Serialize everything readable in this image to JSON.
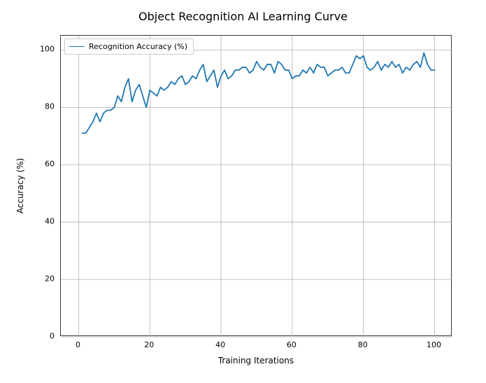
{
  "chart_data": {
    "type": "line",
    "title": "Object Recognition AI Learning Curve",
    "xlabel": "Training Iterations",
    "ylabel": "Accuracy (%)",
    "xlim": [
      -5,
      105
    ],
    "ylim": [
      0,
      105
    ],
    "xticks": [
      0,
      20,
      40,
      60,
      80,
      100
    ],
    "yticks": [
      0,
      20,
      40,
      60,
      80,
      100
    ],
    "legend": {
      "position": "upper-left"
    },
    "series": [
      {
        "name": "Recognition Accuracy (%)",
        "color": "#1f77b4",
        "x": [
          1,
          2,
          3,
          4,
          5,
          6,
          7,
          8,
          9,
          10,
          11,
          12,
          13,
          14,
          15,
          16,
          17,
          18,
          19,
          20,
          21,
          22,
          23,
          24,
          25,
          26,
          27,
          28,
          29,
          30,
          31,
          32,
          33,
          34,
          35,
          36,
          37,
          38,
          39,
          40,
          41,
          42,
          43,
          44,
          45,
          46,
          47,
          48,
          49,
          50,
          51,
          52,
          53,
          54,
          55,
          56,
          57,
          58,
          59,
          60,
          61,
          62,
          63,
          64,
          65,
          66,
          67,
          68,
          69,
          70,
          71,
          72,
          73,
          74,
          75,
          76,
          77,
          78,
          79,
          80,
          81,
          82,
          83,
          84,
          85,
          86,
          87,
          88,
          89,
          90,
          91,
          92,
          93,
          94,
          95,
          96,
          97,
          98,
          99,
          100
        ],
        "values": [
          71,
          71,
          73,
          75,
          78,
          75,
          78,
          79,
          79,
          80,
          84,
          82,
          87,
          90,
          82,
          86,
          88,
          84,
          80,
          86,
          85,
          84,
          87,
          86,
          87,
          89,
          88,
          90,
          91,
          88,
          89,
          91,
          90,
          93,
          95,
          89,
          91,
          93,
          87,
          91,
          93,
          90,
          91,
          93,
          93,
          94,
          94,
          92,
          93,
          96,
          94,
          93,
          95,
          95,
          92,
          96,
          95,
          93,
          93,
          90,
          91,
          91,
          93,
          92,
          94,
          92,
          95,
          94,
          94,
          91,
          92,
          93,
          93,
          94,
          92,
          92,
          95,
          98,
          97,
          98,
          94,
          93,
          94,
          96,
          93,
          95,
          94,
          96,
          94,
          95,
          92,
          94,
          93,
          95,
          96,
          94,
          99,
          95,
          93,
          93
        ]
      }
    ]
  }
}
